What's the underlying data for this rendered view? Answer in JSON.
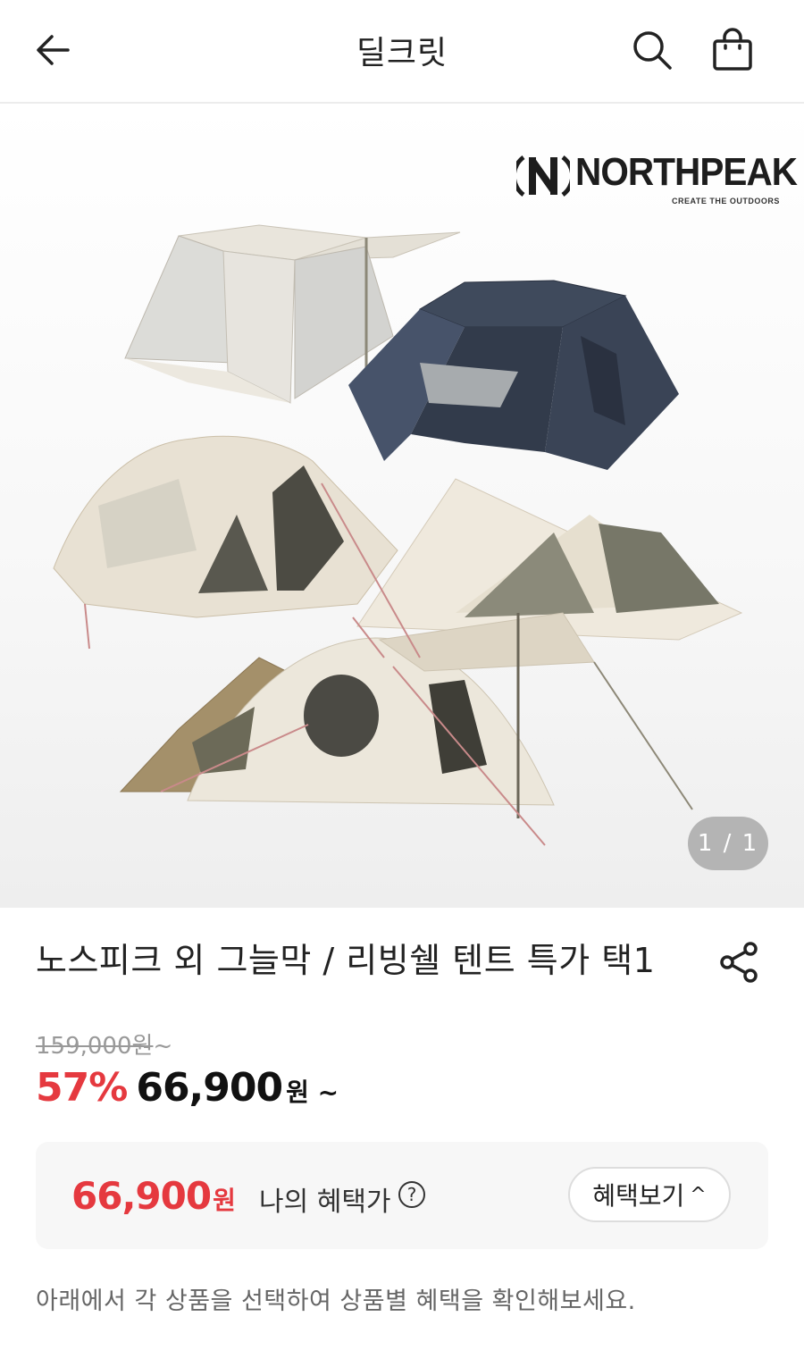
{
  "header": {
    "title": "딜크릿",
    "back_icon": "arrow-left-icon",
    "search_icon": "search-icon",
    "bag_icon": "shopping-bag-icon"
  },
  "hero": {
    "brand_name": "NORTHPEAK",
    "brand_tagline": "CREATE THE OUTDOORS",
    "image_counter": "1 / 1"
  },
  "product": {
    "title": "노스피크 외 그늘막 / 리빙쉘 텐트 특가 택1",
    "original_price": "159,000원",
    "original_suffix": "~",
    "discount_percent": "57%",
    "sale_price": "66,900",
    "sale_won": "원 ~"
  },
  "benefit": {
    "price": "66,900",
    "won": "원",
    "label": "나의 혜택가",
    "help_icon": "?",
    "button_label": "혜택보기",
    "button_chevron": "^"
  },
  "note": "아래에서 각 상품을 선택하여 상품별 혜택을 확인해보세요.",
  "colors": {
    "accent_red": "#e5393f",
    "header_border": "#ececec",
    "benefit_bg": "#f7f7f7"
  }
}
